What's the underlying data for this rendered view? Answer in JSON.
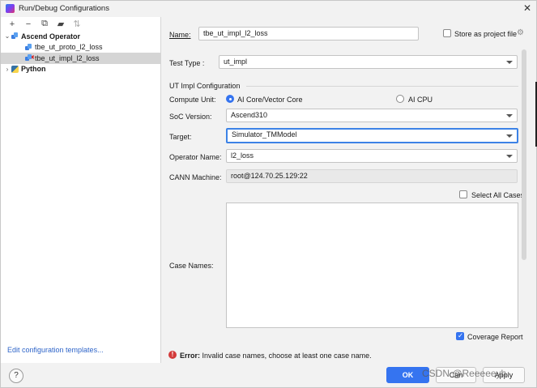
{
  "window": {
    "title": "Run/Debug Configurations",
    "close_glyph": "✕"
  },
  "left": {
    "toolbar": [
      {
        "name": "add-icon",
        "glyph": "+"
      },
      {
        "name": "remove-icon",
        "glyph": "−"
      },
      {
        "name": "copy-icon",
        "glyph": "⧉"
      },
      {
        "name": "folder-icon",
        "glyph": "▰"
      },
      {
        "name": "sort-icon",
        "glyph": "⇅"
      }
    ],
    "tree": {
      "group1": {
        "label": "Ascend Operator",
        "arrow": "⌄"
      },
      "item1": {
        "label": "tbe_ut_proto_l2_loss"
      },
      "item2": {
        "label": "tbe_ut_impl_l2_loss",
        "error_mark": "✖"
      },
      "group2": {
        "label": "Python",
        "arrow": "›"
      }
    },
    "edit_templates": "Edit configuration templates..."
  },
  "form": {
    "name_label": "Name:",
    "name_value": "tbe_ut_impl_l2_loss",
    "store_label": "Store as project file",
    "gear_glyph": "⚙",
    "test_type_label": "Test Type :",
    "test_type_value": "ut_impl",
    "section_title": "UT Impl Configuration",
    "compute_unit_label": "Compute Unit:",
    "compute_options": [
      "AI Core/Vector Core",
      "AI CPU"
    ],
    "soc_label": "SoC Version:",
    "soc_value": "Ascend310",
    "target_label": "Target:",
    "target_value": "Simulator_TMModel",
    "operator_label": "Operator Name:",
    "operator_value": "l2_loss",
    "cann_label": "CANN Machine:",
    "cann_value": "root@124.70.25.129:22",
    "select_all_label": "Select All Cases",
    "case_names_label": "Case Names:",
    "coverage_label": "Coverage Report",
    "error_icon": "!",
    "error_bold": "Error:",
    "error_text": "Invalid case names, choose at least one case name."
  },
  "bottom": {
    "help": "?",
    "ok": "OK",
    "cancel": "Can",
    "apply": "Apply",
    "watermark": "CSDN @Reeeeeyh"
  }
}
